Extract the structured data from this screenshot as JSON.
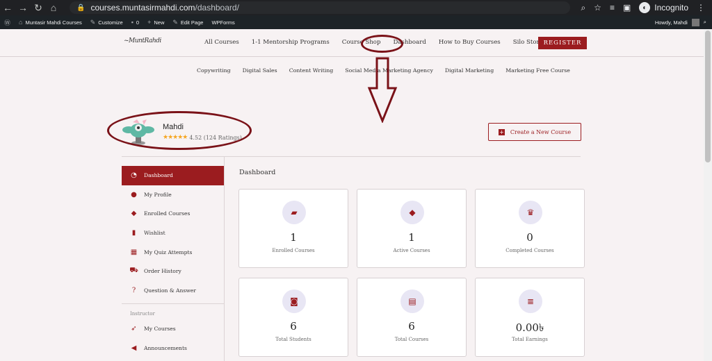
{
  "browser": {
    "url_host": "courses.muntasirmahdi.com",
    "url_path": "/dashboard/",
    "profile_label": "Incognito"
  },
  "wp_bar": {
    "site_name": "Muntasir Mahdi Courses",
    "customize": "Customize",
    "comments_count": "0",
    "new": "New",
    "edit_page": "Edit Page",
    "wpforms": "WPForms",
    "howdy": "Howdy, Mahdi"
  },
  "header": {
    "nav": [
      "All Courses",
      "1-1 Mentorship Programs",
      "Course Shop",
      "Dashboard",
      "How to Buy Courses",
      "Silo Store"
    ],
    "register": "REGISTER"
  },
  "sub_nav": [
    "Copywriting",
    "Digital Sales",
    "Content Writing",
    "Social Media Marketing Agency",
    "Digital Marketing",
    "Marketing Free Course"
  ],
  "profile": {
    "name": "Mahdi",
    "stars": "★★★★★",
    "rating_text": "4.52 (124 Ratings)"
  },
  "create_course": "Create a New Course",
  "sidebar": {
    "items": [
      {
        "label": "Dashboard",
        "icon": "dashboard-icon"
      },
      {
        "label": "My Profile",
        "icon": "user-icon"
      },
      {
        "label": "Enrolled Courses",
        "icon": "graduation-cap-icon"
      },
      {
        "label": "Wishlist",
        "icon": "bookmark-icon"
      },
      {
        "label": "My Quiz Attempts",
        "icon": "quiz-icon"
      },
      {
        "label": "Order History",
        "icon": "cart-icon"
      },
      {
        "label": "Question & Answer",
        "icon": "question-icon"
      }
    ],
    "instructor_heading": "Instructor",
    "instructor_items": [
      {
        "label": "My Courses",
        "icon": "rocket-icon"
      },
      {
        "label": "Announcements",
        "icon": "megaphone-icon"
      }
    ]
  },
  "dashboard_title": "Dashboard",
  "cards": [
    {
      "value": "1",
      "label": "Enrolled Courses",
      "icon": "book-icon"
    },
    {
      "value": "1",
      "label": "Active Courses",
      "icon": "graduation-cap-icon"
    },
    {
      "value": "0",
      "label": "Completed Courses",
      "icon": "trophy-icon"
    },
    {
      "value": "6",
      "label": "Total Students",
      "icon": "student-icon"
    },
    {
      "value": "6",
      "label": "Total Courses",
      "icon": "box-icon"
    },
    {
      "value": "0.00৳",
      "label": "Total Earnings",
      "icon": "coins-icon"
    }
  ],
  "colors": {
    "brand": "#9b1c1f",
    "annotation": "#7a1218"
  }
}
